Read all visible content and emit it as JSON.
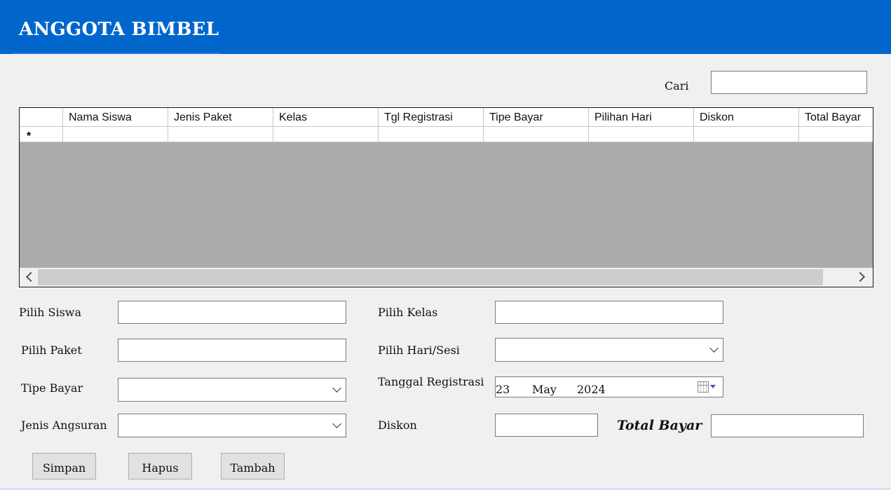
{
  "header": {
    "title": "ANGGOTA BIMBEL",
    "bg_color": "#0066cc"
  },
  "search": {
    "label": "Cari",
    "value": ""
  },
  "table": {
    "columns": [
      "Nama Siswa",
      "Jenis Paket",
      "Kelas",
      "Tgl Registrasi",
      "Tipe Bayar",
      "Pilihan Hari",
      "Diskon",
      "Total Bayar"
    ],
    "new_row_marker": "*"
  },
  "form": {
    "pilih_siswa": {
      "label": "Pilih Siswa",
      "value": ""
    },
    "pilih_paket": {
      "label": "Pilih Paket",
      "value": ""
    },
    "tipe_bayar": {
      "label": "Tipe Bayar",
      "value": ""
    },
    "jenis_angsuran": {
      "label": "Jenis Angsuran",
      "value": ""
    },
    "pilih_kelas": {
      "label": "Pilih Kelas",
      "value": ""
    },
    "pilih_hari_sesi": {
      "label": "Pilih Hari/Sesi",
      "value": ""
    },
    "tanggal_registrasi": {
      "label": "Tanggal Registrasi",
      "day": "23",
      "month": "May",
      "year": "2024"
    },
    "diskon": {
      "label": "Diskon",
      "value": ""
    },
    "total_bayar": {
      "label": "Total Bayar",
      "value": ""
    }
  },
  "buttons": {
    "simpan": "Simpan",
    "hapus": "Hapus",
    "tambah": "Tambah"
  },
  "icons": {
    "calendar": "calendar-icon",
    "dropdown": "chevron-down-icon",
    "scroll_left": "chevron-left-icon",
    "scroll_right": "chevron-right-icon"
  }
}
